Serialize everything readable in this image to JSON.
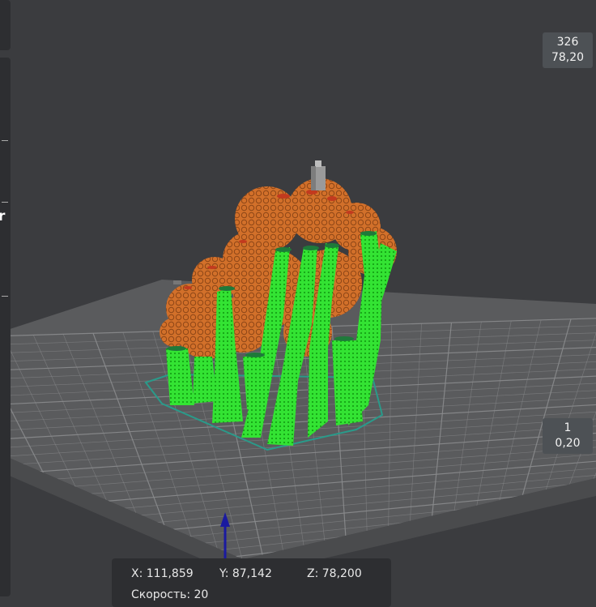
{
  "viewport": {
    "background_color": "#3b3c3f",
    "bed_color": "#5a5b5d",
    "grid_color": "#8a8b8d",
    "infill_color": "#d4742a",
    "support_color": "#2ee02e",
    "skirt_color": "#2a9a8a",
    "nozzle_icon": "nozzle-icon",
    "z_axis_icon": "z-axis-arrow-icon",
    "z_axis_color": "#1a1aa0"
  },
  "sidebar": {
    "truncated_label": "r"
  },
  "layer_slider": {
    "top_layer": "326",
    "top_height": "78,20",
    "bottom_layer": "1",
    "bottom_height": "0,20"
  },
  "position_readout": {
    "x": "X: 111,859",
    "y": "Y: 87,142",
    "z": "Z: 78,200",
    "speed": "Скорость: 20"
  }
}
